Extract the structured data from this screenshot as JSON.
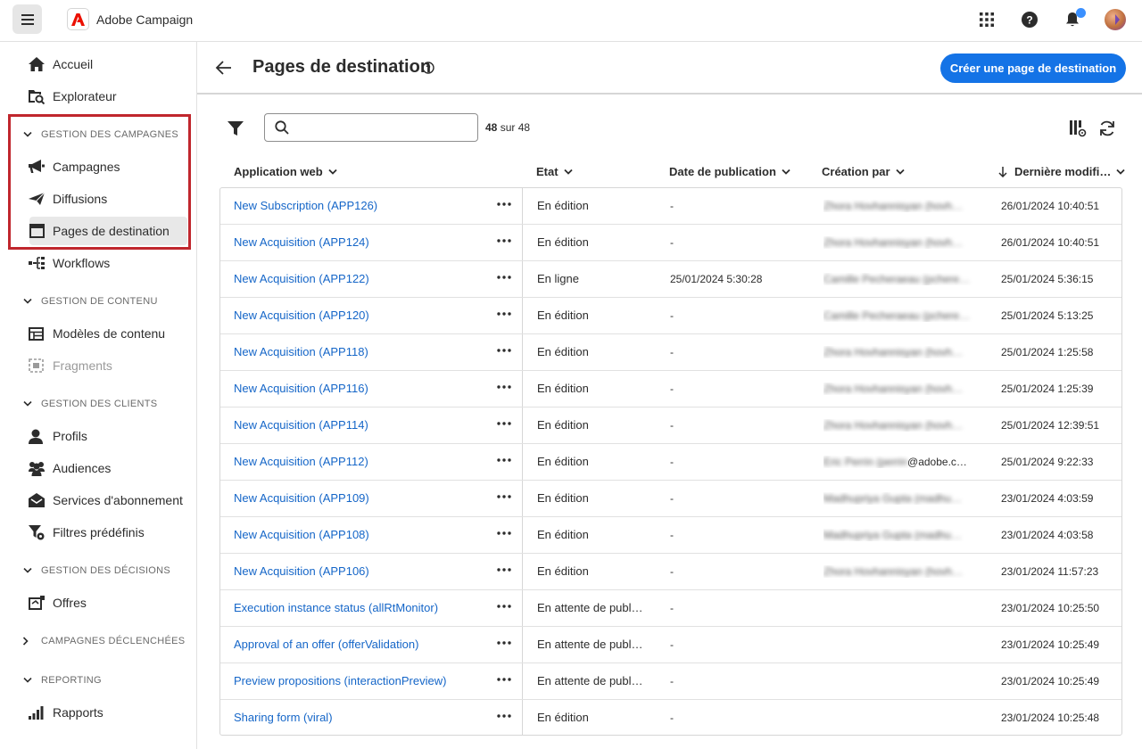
{
  "app": {
    "name": "Adobe Campaign"
  },
  "sidebar": {
    "items": [
      {
        "label": "Accueil",
        "icon": "home-icon"
      },
      {
        "label": "Explorateur",
        "icon": "explorer-icon"
      }
    ],
    "sections": [
      {
        "label": "GESTION DES CAMPAGNES",
        "items": [
          {
            "label": "Campagnes",
            "icon": "megaphone-icon"
          },
          {
            "label": "Diffusions",
            "icon": "send-icon"
          },
          {
            "label": "Pages de destination",
            "icon": "web-page-icon"
          },
          {
            "label": "Workflows",
            "icon": "workflow-icon"
          }
        ]
      },
      {
        "label": "GESTION DE CONTENU",
        "items": [
          {
            "label": "Modèles de contenu",
            "icon": "template-icon"
          },
          {
            "label": "Fragments",
            "icon": "fragment-icon"
          }
        ]
      },
      {
        "label": "GESTION DES CLIENTS",
        "items": [
          {
            "label": "Profils",
            "icon": "user-icon"
          },
          {
            "label": "Audiences",
            "icon": "audience-icon"
          },
          {
            "label": "Services d'abonnement",
            "icon": "subscription-icon"
          },
          {
            "label": "Filtres prédéfinis",
            "icon": "filter-icon"
          }
        ]
      },
      {
        "label": "GESTION DES DÉCISIONS",
        "items": [
          {
            "label": "Offres",
            "icon": "offer-icon"
          }
        ]
      },
      {
        "label": "CAMPAGNES DÉCLENCHÉES",
        "items": []
      },
      {
        "label": "REPORTING",
        "items": [
          {
            "label": "Rapports",
            "icon": "chart-icon"
          }
        ]
      }
    ]
  },
  "header": {
    "title": "Pages de destination",
    "create_label": "Créer une page de destination"
  },
  "toolbar": {
    "search_placeholder": "",
    "count_bold": "48",
    "count_rest": " sur 48"
  },
  "table": {
    "columns": [
      "Application web",
      "Etat",
      "Date de publication",
      "Création par",
      "Dernière modifi…"
    ],
    "rows": [
      {
        "app": "New Subscription (APP126)",
        "state": "En édition",
        "pub": "-",
        "author_blur": "Zhora Hovhannisyan (hovh…",
        "modif": "26/01/2024 10:40:51"
      },
      {
        "app": "New Acquisition (APP124)",
        "state": "En édition",
        "pub": "-",
        "author_blur": "Zhora Hovhannisyan (hovh…",
        "modif": "26/01/2024 10:40:51"
      },
      {
        "app": "New Acquisition (APP122)",
        "state": "En ligne",
        "pub": "25/01/2024 5:30:28",
        "author_blur": "Camille Pecheraeau (pchere…",
        "modif": "25/01/2024 5:36:15"
      },
      {
        "app": "New Acquisition (APP120)",
        "state": "En édition",
        "pub": "-",
        "author_blur": "Camille Pecheraeau (pchere…",
        "modif": "25/01/2024 5:13:25"
      },
      {
        "app": "New Acquisition (APP118)",
        "state": "En édition",
        "pub": "-",
        "author_blur": "Zhora Hovhannisyan (hovh…",
        "modif": "25/01/2024 1:25:58"
      },
      {
        "app": "New Acquisition (APP116)",
        "state": "En édition",
        "pub": "-",
        "author_blur": "Zhora Hovhannisyan (hovh…",
        "modif": "25/01/2024 1:25:39"
      },
      {
        "app": "New Acquisition (APP114)",
        "state": "En édition",
        "pub": "-",
        "author_blur": "Zhora Hovhannisyan (hovh…",
        "modif": "25/01/2024 12:39:51"
      },
      {
        "app": "New Acquisition (APP112)",
        "state": "En édition",
        "pub": "-",
        "author_blur": "Eric Perrin (perrin",
        "author_tail": "@adobe.c…",
        "modif": "25/01/2024 9:22:33"
      },
      {
        "app": "New Acquisition (APP109)",
        "state": "En édition",
        "pub": "-",
        "author_blur": "Madhupriya Gupta (madhu…",
        "modif": "23/01/2024 4:03:59"
      },
      {
        "app": "New Acquisition (APP108)",
        "state": "En édition",
        "pub": "-",
        "author_blur": "Madhupriya Gupta (madhu…",
        "modif": "23/01/2024 4:03:58"
      },
      {
        "app": "New Acquisition (APP106)",
        "state": "En édition",
        "pub": "-",
        "author_blur": "Zhora Hovhannisyan (hovh…",
        "modif": "23/01/2024 11:57:23"
      },
      {
        "app": "Execution instance status (allRtMonitor)",
        "state": "En attente de publ…",
        "pub": "-",
        "author_blur": "",
        "modif": "23/01/2024 10:25:50"
      },
      {
        "app": "Approval of an offer (offerValidation)",
        "state": "En attente de publ…",
        "pub": "-",
        "author_blur": "",
        "modif": "23/01/2024 10:25:49"
      },
      {
        "app": "Preview propositions (interactionPreview)",
        "state": "En attente de publ…",
        "pub": "-",
        "author_blur": "",
        "modif": "23/01/2024 10:25:49"
      },
      {
        "app": "Sharing form (viral)",
        "state": "En édition",
        "pub": "-",
        "author_blur": "",
        "modif": "23/01/2024 10:25:48"
      }
    ]
  },
  "colors": {
    "accent": "#1473e6",
    "link": "#1566c8",
    "highlight": "#c0262d"
  }
}
